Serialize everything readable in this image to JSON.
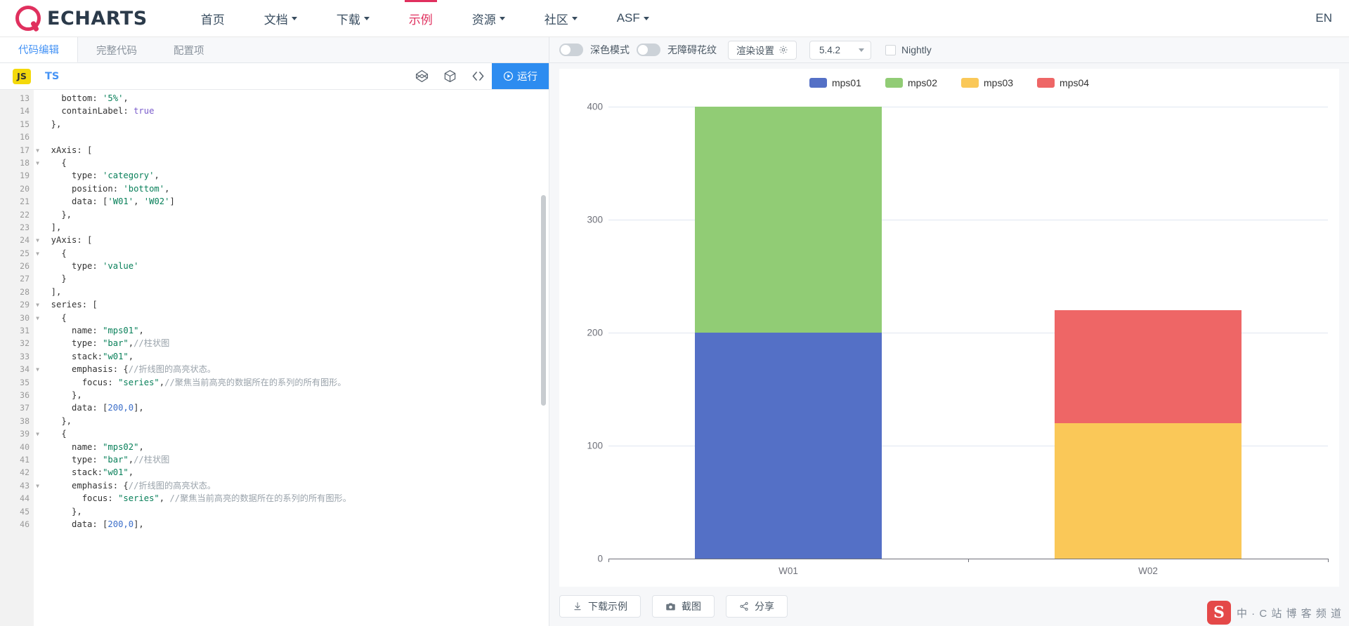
{
  "topnav": {
    "brand": "ECHARTS",
    "items": [
      {
        "label": "首页",
        "has_caret": false,
        "active": false
      },
      {
        "label": "文档",
        "has_caret": true,
        "active": false
      },
      {
        "label": "下载",
        "has_caret": true,
        "active": false
      },
      {
        "label": "示例",
        "has_caret": false,
        "active": true
      },
      {
        "label": "资源",
        "has_caret": true,
        "active": false
      },
      {
        "label": "社区",
        "has_caret": true,
        "active": false
      },
      {
        "label": "ASF",
        "has_caret": true,
        "active": false
      }
    ],
    "lang": "EN",
    "accent_color": "#e0305e"
  },
  "editor_panel": {
    "tabs": [
      {
        "label": "代码编辑",
        "active": true
      },
      {
        "label": "完整代码",
        "active": false
      },
      {
        "label": "配置项",
        "active": false
      }
    ],
    "lang_js": "JS",
    "lang_ts": "TS",
    "icons": [
      "codepen-icon",
      "codesandbox-icon",
      "code-brackets-icon"
    ],
    "run_label": "运行",
    "run_icon": "play-circle-icon",
    "first_line_number": 13,
    "lines": [
      {
        "n": 13,
        "fold": false,
        "tokens": [
          {
            "t": "    bottom: ",
            "c": "k-pn"
          },
          {
            "t": "'5%'",
            "c": "k-str"
          },
          {
            "t": ",",
            "c": "k-pn"
          }
        ]
      },
      {
        "n": 14,
        "fold": false,
        "tokens": [
          {
            "t": "    containLabel: ",
            "c": "k-pn"
          },
          {
            "t": "true",
            "c": "k-kw"
          }
        ]
      },
      {
        "n": 15,
        "fold": false,
        "tokens": [
          {
            "t": "  },",
            "c": "k-pn"
          }
        ]
      },
      {
        "n": 16,
        "fold": false,
        "tokens": [
          {
            "t": "",
            "c": "k-pn"
          }
        ]
      },
      {
        "n": 17,
        "fold": true,
        "tokens": [
          {
            "t": "  xAxis: [",
            "c": "k-pn"
          }
        ]
      },
      {
        "n": 18,
        "fold": true,
        "tokens": [
          {
            "t": "    {",
            "c": "k-pn"
          }
        ]
      },
      {
        "n": 19,
        "fold": false,
        "tokens": [
          {
            "t": "      type: ",
            "c": "k-pn"
          },
          {
            "t": "'category'",
            "c": "k-str"
          },
          {
            "t": ",",
            "c": "k-pn"
          }
        ]
      },
      {
        "n": 20,
        "fold": false,
        "tokens": [
          {
            "t": "      position: ",
            "c": "k-pn"
          },
          {
            "t": "'bottom'",
            "c": "k-str"
          },
          {
            "t": ",",
            "c": "k-pn"
          }
        ]
      },
      {
        "n": 21,
        "fold": false,
        "tokens": [
          {
            "t": "      data: [",
            "c": "k-pn"
          },
          {
            "t": "'W01'",
            "c": "k-str"
          },
          {
            "t": ", ",
            "c": "k-pn"
          },
          {
            "t": "'W02'",
            "c": "k-str"
          },
          {
            "t": "]",
            "c": "k-pn"
          }
        ]
      },
      {
        "n": 22,
        "fold": false,
        "tokens": [
          {
            "t": "    },",
            "c": "k-pn"
          }
        ]
      },
      {
        "n": 23,
        "fold": false,
        "tokens": [
          {
            "t": "  ],",
            "c": "k-pn"
          }
        ]
      },
      {
        "n": 24,
        "fold": true,
        "tokens": [
          {
            "t": "  yAxis: [",
            "c": "k-pn"
          }
        ]
      },
      {
        "n": 25,
        "fold": true,
        "tokens": [
          {
            "t": "    {",
            "c": "k-pn"
          }
        ]
      },
      {
        "n": 26,
        "fold": false,
        "tokens": [
          {
            "t": "      type: ",
            "c": "k-pn"
          },
          {
            "t": "'value'",
            "c": "k-str"
          }
        ]
      },
      {
        "n": 27,
        "fold": false,
        "tokens": [
          {
            "t": "    }",
            "c": "k-pn"
          }
        ]
      },
      {
        "n": 28,
        "fold": false,
        "tokens": [
          {
            "t": "  ],",
            "c": "k-pn"
          }
        ]
      },
      {
        "n": 29,
        "fold": true,
        "tokens": [
          {
            "t": "  series: [",
            "c": "k-pn"
          }
        ]
      },
      {
        "n": 30,
        "fold": true,
        "tokens": [
          {
            "t": "    {",
            "c": "k-pn"
          }
        ]
      },
      {
        "n": 31,
        "fold": false,
        "tokens": [
          {
            "t": "      name: ",
            "c": "k-pn"
          },
          {
            "t": "\"mps01\"",
            "c": "k-str"
          },
          {
            "t": ",",
            "c": "k-pn"
          }
        ]
      },
      {
        "n": 32,
        "fold": false,
        "tokens": [
          {
            "t": "      type: ",
            "c": "k-pn"
          },
          {
            "t": "\"bar\"",
            "c": "k-str"
          },
          {
            "t": ",",
            "c": "k-pn"
          },
          {
            "t": "//柱状图",
            "c": "k-com"
          }
        ]
      },
      {
        "n": 33,
        "fold": false,
        "tokens": [
          {
            "t": "      stack:",
            "c": "k-pn"
          },
          {
            "t": "\"w01\"",
            "c": "k-str"
          },
          {
            "t": ",",
            "c": "k-pn"
          }
        ]
      },
      {
        "n": 34,
        "fold": true,
        "tokens": [
          {
            "t": "      emphasis: {",
            "c": "k-pn"
          },
          {
            "t": "//折线图的高亮状态。",
            "c": "k-com"
          }
        ]
      },
      {
        "n": 35,
        "fold": false,
        "tokens": [
          {
            "t": "        focus: ",
            "c": "k-pn"
          },
          {
            "t": "\"series\"",
            "c": "k-str"
          },
          {
            "t": ",",
            "c": "k-pn"
          },
          {
            "t": "//聚焦当前高亮的数据所在的系列的所有图形。",
            "c": "k-com"
          }
        ]
      },
      {
        "n": 36,
        "fold": false,
        "tokens": [
          {
            "t": "      },",
            "c": "k-pn"
          }
        ]
      },
      {
        "n": 37,
        "fold": false,
        "tokens": [
          {
            "t": "      data: [",
            "c": "k-pn"
          },
          {
            "t": "200,0",
            "c": "k-num"
          },
          {
            "t": "],",
            "c": "k-pn"
          }
        ]
      },
      {
        "n": 38,
        "fold": false,
        "tokens": [
          {
            "t": "    },",
            "c": "k-pn"
          }
        ]
      },
      {
        "n": 39,
        "fold": true,
        "tokens": [
          {
            "t": "    {",
            "c": "k-pn"
          }
        ]
      },
      {
        "n": 40,
        "fold": false,
        "tokens": [
          {
            "t": "      name: ",
            "c": "k-pn"
          },
          {
            "t": "\"mps02\"",
            "c": "k-str"
          },
          {
            "t": ",",
            "c": "k-pn"
          }
        ]
      },
      {
        "n": 41,
        "fold": false,
        "tokens": [
          {
            "t": "      type: ",
            "c": "k-pn"
          },
          {
            "t": "\"bar\"",
            "c": "k-str"
          },
          {
            "t": ",",
            "c": "k-pn"
          },
          {
            "t": "//柱状图",
            "c": "k-com"
          }
        ]
      },
      {
        "n": 42,
        "fold": false,
        "tokens": [
          {
            "t": "      stack:",
            "c": "k-pn"
          },
          {
            "t": "\"w01\"",
            "c": "k-str"
          },
          {
            "t": ",",
            "c": "k-pn"
          }
        ]
      },
      {
        "n": 43,
        "fold": true,
        "tokens": [
          {
            "t": "      emphasis: {",
            "c": "k-pn"
          },
          {
            "t": "//折线图的高亮状态。",
            "c": "k-com"
          }
        ]
      },
      {
        "n": 44,
        "fold": false,
        "tokens": [
          {
            "t": "        focus: ",
            "c": "k-pn"
          },
          {
            "t": "\"series\"",
            "c": "k-str"
          },
          {
            "t": ", ",
            "c": "k-pn"
          },
          {
            "t": "//聚焦当前高亮的数据所在的系列的所有图形。",
            "c": "k-com"
          }
        ]
      },
      {
        "n": 45,
        "fold": false,
        "tokens": [
          {
            "t": "      },",
            "c": "k-pn"
          }
        ]
      },
      {
        "n": 46,
        "fold": false,
        "tokens": [
          {
            "t": "      data: [",
            "c": "k-pn"
          },
          {
            "t": "200,0",
            "c": "k-num"
          },
          {
            "t": "],",
            "c": "k-pn"
          }
        ]
      }
    ]
  },
  "preview_bar": {
    "dark_mode_label": "深色模式",
    "dark_mode_on": false,
    "accessible_label": "无障碍花纹",
    "accessible_on": false,
    "render_settings_label": "渲染设置",
    "render_settings_icon": "gear-icon",
    "version": "5.4.2",
    "nightly_label": "Nightly",
    "nightly_checked": false
  },
  "chart_data": {
    "type": "bar",
    "stacked": true,
    "title": "",
    "xlabel": "",
    "ylabel": "",
    "categories": [
      "W01",
      "W02"
    ],
    "yticks": [
      0,
      100,
      200,
      300,
      400
    ],
    "ylim": [
      0,
      400
    ],
    "grid": true,
    "legend_position": "top-center",
    "series": [
      {
        "name": "mps01",
        "color": "#5470c6",
        "values": [
          200,
          0
        ]
      },
      {
        "name": "mps02",
        "color": "#91cc75",
        "values": [
          200,
          0
        ]
      },
      {
        "name": "mps03",
        "color": "#fac858",
        "values": [
          0,
          120
        ]
      },
      {
        "name": "mps04",
        "color": "#ee6666",
        "values": [
          0,
          100
        ]
      }
    ]
  },
  "footer": {
    "buttons": [
      {
        "label": "下载示例",
        "icon": "download-icon"
      },
      {
        "label": "截图",
        "icon": "camera-icon"
      },
      {
        "label": "分享",
        "icon": "share-icon"
      }
    ],
    "watermark_mark": "S",
    "watermark_text": "中 · C 站 博 客 频 道"
  }
}
